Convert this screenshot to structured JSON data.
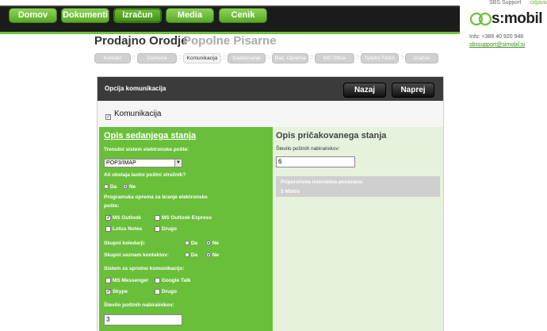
{
  "nav": {
    "items": [
      "Domov",
      "Dokumenti",
      "Izračun",
      "Media",
      "Cenik"
    ],
    "active": "Izračun"
  },
  "top_right": {
    "sbs_support": "SBS Support",
    "odjava": "odjava",
    "logo_text": "s:mobil",
    "info": "Info: +386 40 920 946",
    "email": "sbssupport@simobil.si"
  },
  "title": {
    "main": "Prodajno Orodje",
    "sub": "Popolne Pisarne"
  },
  "steps": [
    "Kontakt",
    "Domena",
    "Komunikacija",
    "Sodelovanje",
    "Rač. Oprema",
    "MS Office",
    "Spletni FAKS",
    "Izračun"
  ],
  "panel": {
    "title": "Opcija komunikacija",
    "btn_back": "Nazaj",
    "btn_next": "Naprej",
    "komunikacija_label": "Komunikacija"
  },
  "left": {
    "heading": "Opis sedanjega stanja",
    "q_email_system": "Trenutni sistem elektronske pošte:",
    "email_system_value": "POP3/IMAP",
    "q_own_server": "Ali obstaja lastni poštni strežnik?",
    "da": "Da",
    "ne": "Ne",
    "q_email_software_1": "Programska oprema za branje elektronske",
    "q_email_software_2": "pošte:",
    "ms_outlook": "MS Outlook",
    "ms_outlook_express": "MS Outlook Express",
    "lotus_notes": "Lotus Notes",
    "drugo": "Drugo",
    "q_shared_calendars": "Skupni koledarji:",
    "q_shared_contacts": "Skupni seznam kontaktov:",
    "q_instant_messaging": "Sistem za sprotno komunikacijo:",
    "ms_messenger": "MS Messenger",
    "google_talk": "Google Talk",
    "skype": "Skype",
    "q_mailboxes": "Število poštnih nabiralnikov:",
    "mailboxes_value": "3"
  },
  "right": {
    "heading": "Opis pričakovanega stanja",
    "q_mailboxes": "Število poštnih nabiralnikov:",
    "mailboxes_value": "6",
    "conn_label": "Priporočena internetna povezava:",
    "conn_value": "5 Mbit/s"
  }
}
